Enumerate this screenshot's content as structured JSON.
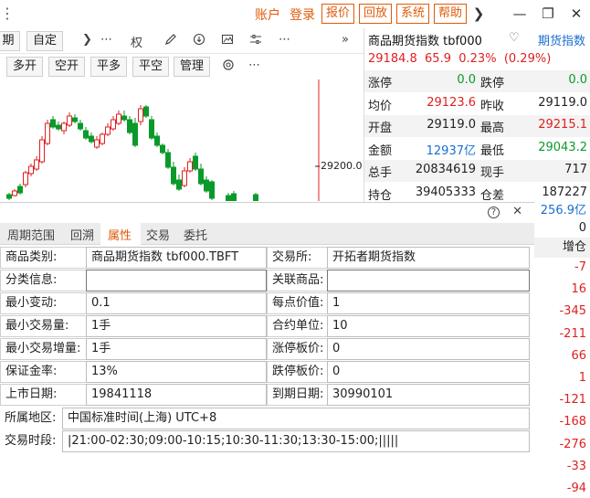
{
  "title_bar": {
    "left_glyph": "⋮",
    "menu": [
      "账户",
      "登录"
    ],
    "buttons": [
      "报价",
      "回放",
      "系统",
      "帮助"
    ],
    "chevron": "❯",
    "minimize": "—",
    "maximize": "❐",
    "close": "✕"
  },
  "chart_toolbar": {
    "row1": {
      "period_partial": "期",
      "custom": "自定",
      "more": "⋯",
      "chevron": "❯",
      "quan": "权",
      "expand": "»"
    },
    "row2": {
      "buttons": [
        "多开",
        "空开",
        "平多",
        "平空",
        "管理"
      ],
      "more": "⋯"
    }
  },
  "chart": {
    "price_tag": "29200.0",
    "colors": {
      "up": "#e02020",
      "down": "#0a9a2a",
      "crosshair": "#e02020"
    }
  },
  "quote": {
    "title": "商品期货指数 tbf000",
    "fav_icon": "♡",
    "tab": "期货指数",
    "last": "29184.8",
    "change": "65.9",
    "pct": "0.23%",
    "pct_paren": "(0.29%)",
    "rows": [
      {
        "l1": "涨停",
        "v1": "0.0",
        "c1": "green",
        "l2": "跌停",
        "v2": "0.0",
        "c2": "green"
      },
      {
        "l1": "均价",
        "v1": "29123.6",
        "c1": "red",
        "l2": "昨收",
        "v2": "29119.0",
        "c2": "black"
      },
      {
        "l1": "开盘",
        "v1": "29119.0",
        "c1": "black",
        "l2": "最高",
        "v2": "29215.1",
        "c2": "red"
      },
      {
        "l1": "金额",
        "v1": "12937亿",
        "c1": "blue",
        "l2": "最低",
        "v2": "29043.2",
        "c2": "green"
      },
      {
        "l1": "总手",
        "v1": "20834619",
        "c1": "black",
        "l2": "现手",
        "v2": "717",
        "c2": "black"
      },
      {
        "l1": "持仓",
        "v1": "39405333",
        "c1": "black",
        "l2": "仓差",
        "v2": "187227",
        "c2": "black"
      }
    ]
  },
  "side": {
    "top_val": "256.9亿",
    "zero": "0",
    "header": "增仓",
    "values": [
      "-7",
      "16",
      "-345",
      "-211",
      "66",
      "1",
      "-121",
      "-168",
      "-276",
      "-33",
      "-94",
      "-21"
    ]
  },
  "props": {
    "help_icon": "?",
    "close_icon": "✕",
    "tabs": [
      "周期范围",
      "回溯",
      "属性",
      "交易",
      "委托"
    ],
    "rows": [
      {
        "l1": "商品类别:",
        "v1": "商品期货指数 tbf000.TBFT",
        "l2": "交易所:",
        "v2": "开拓者期货指数"
      },
      {
        "l1": "分类信息:",
        "v1": "",
        "l2": "关联商品:",
        "v2": ""
      },
      {
        "l1": "最小变动:",
        "v1": "0.1",
        "l2": "每点价值:",
        "v2": "1"
      },
      {
        "l1": "最小交易量:",
        "v1": "1手",
        "l2": "合约单位:",
        "v2": "10"
      },
      {
        "l1": "最小交易增量:",
        "v1": "1手",
        "l2": "涨停板价:",
        "v2": "0"
      },
      {
        "l1": "保证金率:",
        "v1": "13%",
        "l2": "跌停板价:",
        "v2": "0"
      },
      {
        "l1": "上市日期:",
        "v1": "19841118",
        "l2": "到期日期:",
        "v2": "30990101"
      }
    ],
    "region_label": "所属地区:",
    "region_value": "中国标准时间(上海) UTC+8",
    "session_label": "交易时段:",
    "session_value": "|21:00-02:30;09:00-10:15;10:30-11:30;13:30-15:00;|||||"
  }
}
